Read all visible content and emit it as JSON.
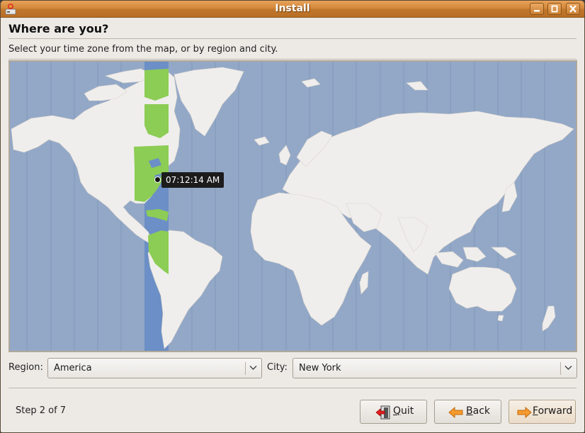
{
  "window": {
    "title": "Install",
    "controls": [
      "minimize",
      "maximize",
      "close"
    ]
  },
  "page": {
    "heading": "Where are you?",
    "subtitle": "Select your time zone from the map, or by region and city."
  },
  "map": {
    "selected_timezone_time": "07:12:14 AM",
    "selected_city_marker": "New York",
    "colors": {
      "ocean": "#93a8c7",
      "land": "#f0eeec",
      "selected_zone_band": "#6b8fc6",
      "selected_zone_land": "#8ccd55"
    }
  },
  "selectors": {
    "region": {
      "label": "Region:",
      "value": "America"
    },
    "city": {
      "label": "City:",
      "value": "New York"
    }
  },
  "footer": {
    "step_text": "Step 2 of 7",
    "buttons": {
      "quit": {
        "mnemonic": "Q",
        "rest": "uit"
      },
      "back": {
        "mnemonic": "B",
        "rest": "ack"
      },
      "forward": {
        "mnemonic": "F",
        "rest": "orward"
      }
    }
  }
}
